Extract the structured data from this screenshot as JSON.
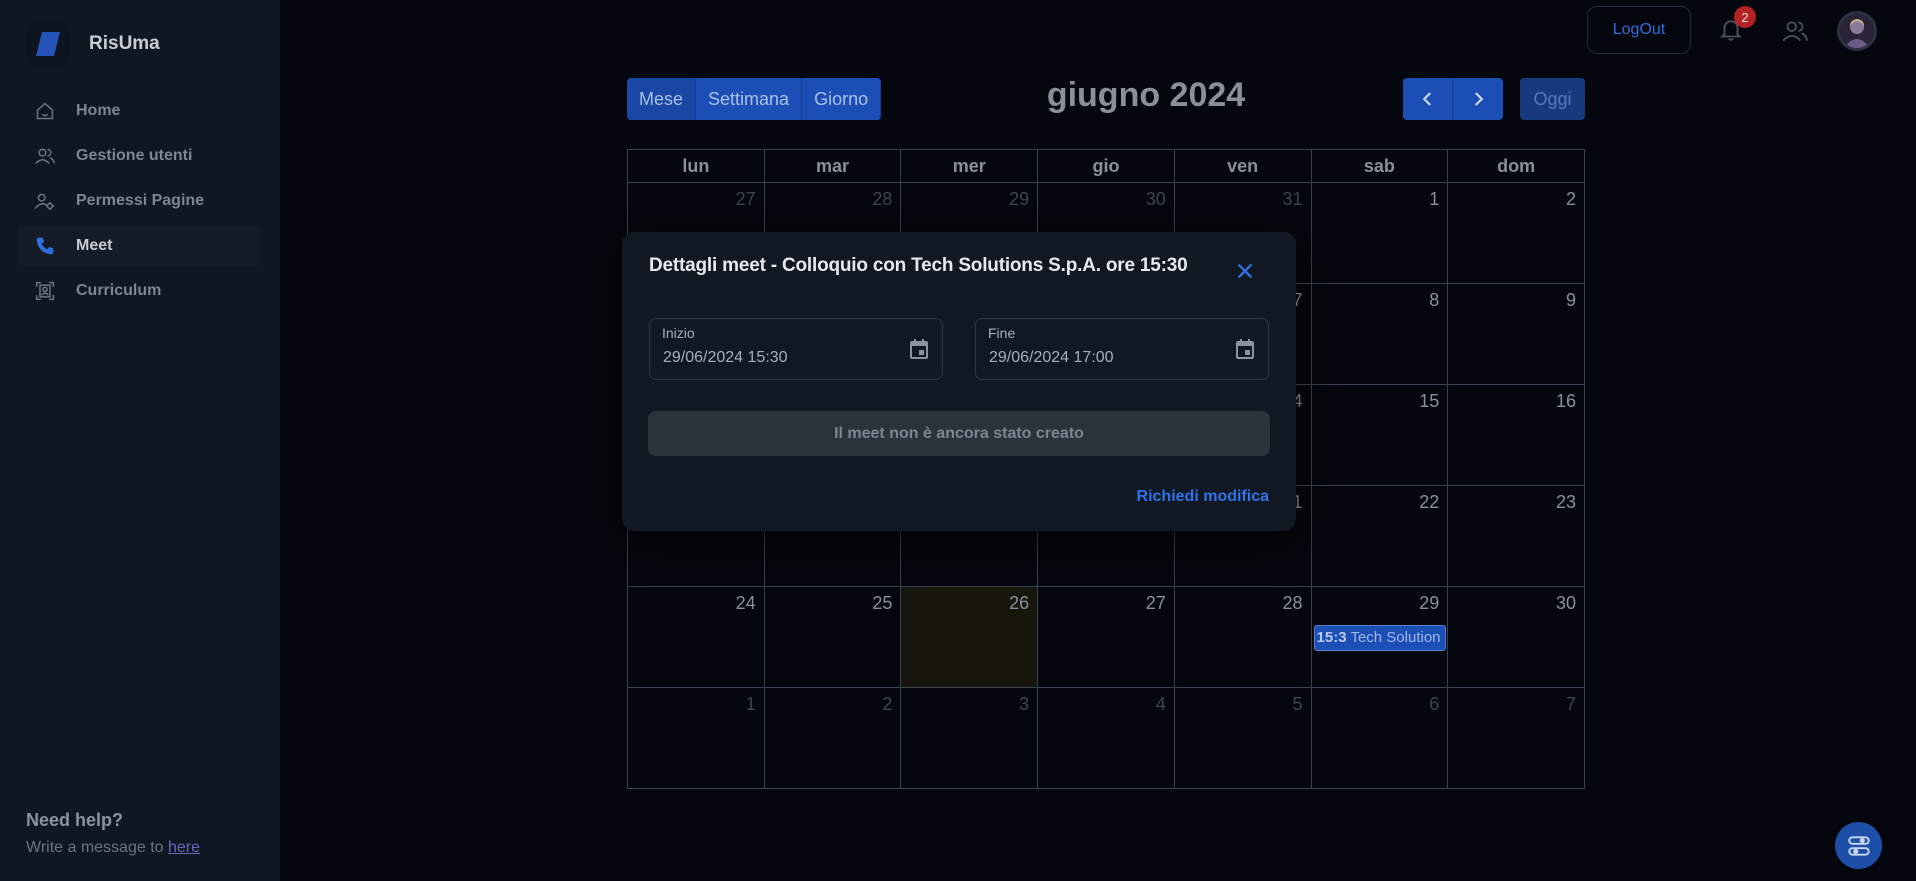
{
  "app": {
    "name": "RisUma"
  },
  "sidebar": {
    "items": [
      {
        "label": "Home",
        "icon": "home-icon"
      },
      {
        "label": "Gestione utenti",
        "icon": "users-icon"
      },
      {
        "label": "Permessi Pagine",
        "icon": "user-gear-icon"
      },
      {
        "label": "Meet",
        "icon": "phone-icon",
        "active": true
      },
      {
        "label": "Curriculum",
        "icon": "scan-user-icon"
      }
    ],
    "help": {
      "title": "Need help?",
      "text": "Write a message to ",
      "link": "here"
    }
  },
  "topbar": {
    "logout_label": "LogOut",
    "notifications_count": "2"
  },
  "calendar": {
    "views": [
      "Mese",
      "Settimana",
      "Giorno"
    ],
    "title": "giugno 2024",
    "today_label": "Oggi",
    "weekdays": [
      "lun",
      "mar",
      "mer",
      "gio",
      "ven",
      "sab",
      "dom"
    ],
    "weeks": [
      [
        "27",
        "28",
        "29",
        "30",
        "31",
        "1",
        "2"
      ],
      [
        "",
        "",
        "",
        "",
        "7",
        "8",
        "9"
      ],
      [
        "",
        "",
        "",
        "",
        "4",
        "15",
        "16"
      ],
      [
        "",
        "",
        "",
        "",
        "1",
        "22",
        "23"
      ],
      [
        "24",
        "25",
        "26",
        "27",
        "28",
        "29",
        "30"
      ],
      [
        "1",
        "2",
        "3",
        "4",
        "5",
        "6",
        "7"
      ]
    ],
    "event": {
      "time": "15:3",
      "title": "Tech Solution"
    }
  },
  "modal": {
    "title": "Dettagli meet - Colloquio con Tech Solutions S.p.A. ore 15:30",
    "start_label": "Inizio",
    "start_value": "29/06/2024 15:30",
    "end_label": "Fine",
    "end_value": "29/06/2024 17:00",
    "status": "Il meet non è ancora stato creato",
    "modify_label": "Richiedi modifica"
  },
  "colors": {
    "accent": "#1b4fb6",
    "link": "#2f73e6",
    "background": "#04070d"
  }
}
